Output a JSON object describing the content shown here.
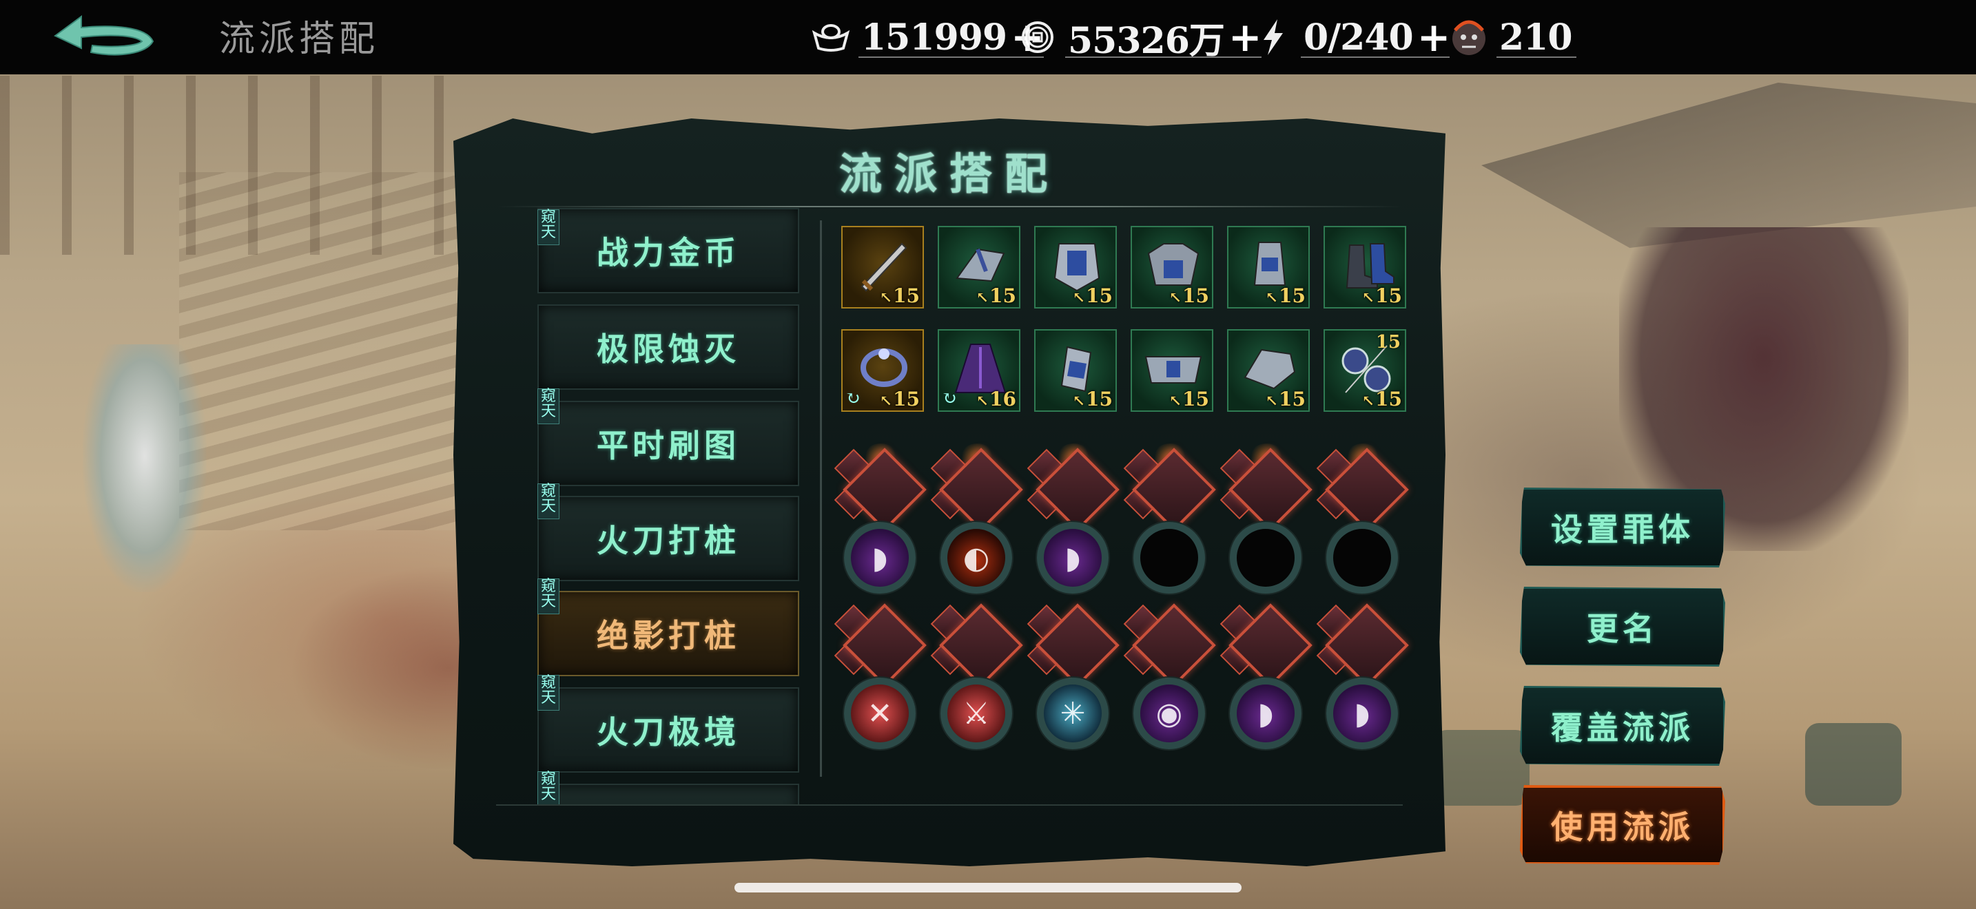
{
  "header": {
    "title": "流派搭配",
    "resources": [
      {
        "icon": "ingot-icon",
        "value": "151999",
        "has_plus": true
      },
      {
        "icon": "coin-icon",
        "value": "55326万",
        "has_plus": true
      },
      {
        "icon": "lightning-icon",
        "value": "0/240",
        "has_plus": true
      },
      {
        "icon": "demon-mask-icon",
        "value": "210",
        "has_plus": false
      }
    ],
    "plus_symbol": "+"
  },
  "panel": {
    "title": "流派搭配",
    "builds": [
      {
        "label": "战力金币",
        "tag": "窥天",
        "selected": false
      },
      {
        "label": "极限蚀灭",
        "tag": "",
        "selected": false
      },
      {
        "label": "平时刷图",
        "tag": "窥天",
        "selected": false
      },
      {
        "label": "火刀打桩",
        "tag": "窥天",
        "selected": false
      },
      {
        "label": "绝影打桩",
        "tag": "窥天",
        "selected": true
      },
      {
        "label": "火刀极境",
        "tag": "窥天",
        "selected": false
      },
      {
        "label": "",
        "tag": "窥天",
        "selected": false
      }
    ],
    "equipment_rows": [
      [
        {
          "icon": "sword-icon",
          "rarity": "gold",
          "level": "15"
        },
        {
          "icon": "shoulder-armor-icon",
          "rarity": "green",
          "level": "15"
        },
        {
          "icon": "chest-armor-icon",
          "rarity": "green",
          "level": "15"
        },
        {
          "icon": "heavy-armor-icon",
          "rarity": "green",
          "level": "15"
        },
        {
          "icon": "gauntlet-icon",
          "rarity": "green",
          "level": "15"
        },
        {
          "icon": "boots-icon",
          "rarity": "green",
          "level": "15"
        }
      ],
      [
        {
          "icon": "bracelet-icon",
          "rarity": "gold",
          "level": "15",
          "cycle": true
        },
        {
          "icon": "cloak-icon",
          "rarity": "green",
          "level": "16",
          "cycle": true
        },
        {
          "icon": "bracer-icon",
          "rarity": "green",
          "level": "15"
        },
        {
          "icon": "belt-icon",
          "rarity": "green",
          "level": "15"
        },
        {
          "icon": "pauldron-icon",
          "rarity": "green",
          "level": "15"
        },
        {
          "icon": "twin-accessory-icon",
          "rarity": "green",
          "level": "15",
          "level_top": "15"
        }
      ]
    ],
    "spirit_rows": [
      [
        "purple",
        "red",
        "purple",
        "dark",
        "dark",
        "dark"
      ],
      [
        "rose",
        "rose",
        "cyan",
        "purple",
        "purple",
        "purple"
      ]
    ]
  },
  "actions": [
    {
      "label": "设置罪体",
      "active": false
    },
    {
      "label": "更名",
      "active": false
    },
    {
      "label": "覆盖流派",
      "active": false
    },
    {
      "label": "使用流派",
      "active": true
    }
  ],
  "colors": {
    "accent_green": "#8ff0cc",
    "accent_orange": "#e05a12",
    "gold_frame": "#a8801e",
    "green_frame": "#2f7a52"
  }
}
